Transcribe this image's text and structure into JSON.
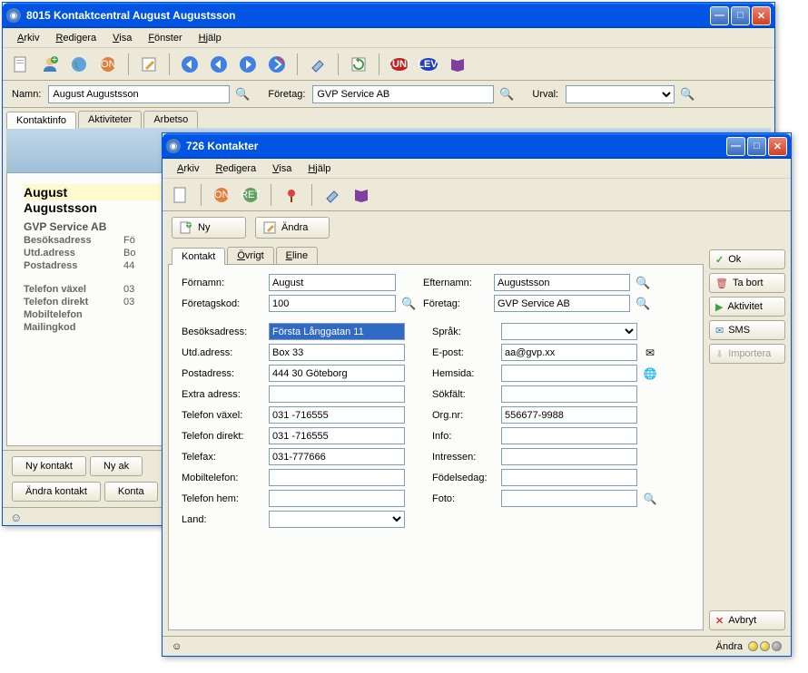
{
  "win1": {
    "title": "8015 Kontaktcentral August Augustsson",
    "menu": [
      "Arkiv",
      "Redigera",
      "Visa",
      "Fönster",
      "Hjälp"
    ],
    "search": {
      "name_label": "Namn:",
      "name_value": "August Augustsson",
      "company_label": "Företag:",
      "company_value": "GVP Service AB",
      "urval_label": "Urval:",
      "urval_value": ""
    },
    "tabs": [
      "Kontaktinfo",
      "Aktiviteter",
      "Arbetso"
    ],
    "card": {
      "firstname": "August",
      "lastname": "Augustsson",
      "company": "GVP Service AB",
      "rows": [
        {
          "label": "Besöksadress",
          "value": "Fö"
        },
        {
          "label": "Utd.adress",
          "value": "Bo"
        },
        {
          "label": "Postadress",
          "value": "44"
        },
        {
          "label": "",
          "value": ""
        },
        {
          "label": "Telefon växel",
          "value": "03"
        },
        {
          "label": "Telefon direkt",
          "value": "03"
        },
        {
          "label": "Mobiltelefon",
          "value": ""
        },
        {
          "label": "Mailingkod",
          "value": ""
        }
      ]
    },
    "buttons": [
      "Ny kontakt",
      "Ny ak",
      "Ändra kontakt",
      "Konta"
    ]
  },
  "win2": {
    "title": "726 Kontakter",
    "menu": [
      "Arkiv",
      "Redigera",
      "Visa",
      "Hjälp"
    ],
    "btn_ny": "Ny",
    "btn_andra": "Ändra",
    "tabs": [
      "Kontakt",
      "Övrigt",
      "Eline"
    ],
    "top_fields": {
      "fornamn_label": "Förnamn:",
      "fornamn": "August",
      "efternamn_label": "Efternamn:",
      "efternamn": "Augustsson",
      "foretagskod_label": "Företagskod:",
      "foretagskod": "100",
      "foretag_label": "Företag:",
      "foretag": "GVP Service AB"
    },
    "left_fields": [
      {
        "label": "Besöksadress:",
        "value": "Första Långgatan 11",
        "hl": true
      },
      {
        "label": "Utd.adress:",
        "value": "Box 33"
      },
      {
        "label": "Postadress:",
        "value": "444 30 Göteborg"
      },
      {
        "label": "Extra adress:",
        "value": ""
      },
      {
        "label": "Telefon växel:",
        "value": "031 -716555"
      },
      {
        "label": "Telefon direkt:",
        "value": "031 -716555"
      },
      {
        "label": "Telefax:",
        "value": "031-777666"
      },
      {
        "label": "Mobiltelefon:",
        "value": ""
      },
      {
        "label": "Telefon hem:",
        "value": ""
      },
      {
        "label": "Land:",
        "value": "",
        "select": true
      }
    ],
    "right_fields": [
      {
        "label": "Språk:",
        "value": "",
        "select": true
      },
      {
        "label": "E-post:",
        "value": "aa@gvp.xx",
        "icon": "mail"
      },
      {
        "label": "Hemsida:",
        "value": "",
        "icon": "web"
      },
      {
        "label": "Sökfält:",
        "value": ""
      },
      {
        "label": "Org.nr:",
        "value": "556677-9988"
      },
      {
        "label": "Info:",
        "value": ""
      },
      {
        "label": "Intressen:",
        "value": ""
      },
      {
        "label": "Födelsedag:",
        "value": ""
      },
      {
        "label": "Foto:",
        "value": "",
        "icon": "mag"
      }
    ],
    "side": {
      "ok": "Ok",
      "tabort": "Ta bort",
      "aktivitet": "Aktivitet",
      "sms": "SMS",
      "importera": "Importera",
      "avbryt": "Avbryt"
    },
    "status": "Ändra"
  }
}
